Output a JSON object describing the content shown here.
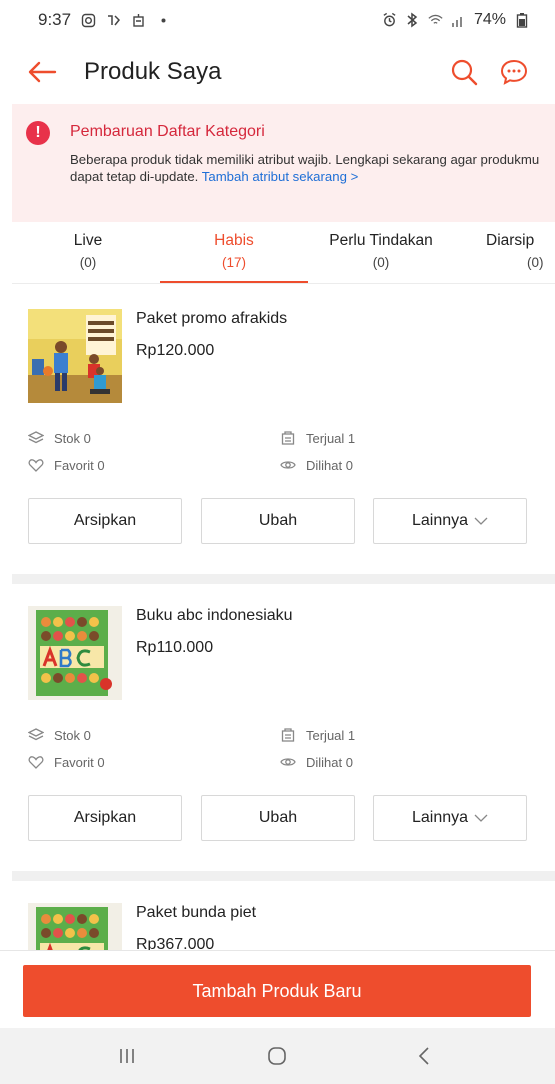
{
  "status_bar": {
    "time": "9:37",
    "battery": "74%",
    "left_icons": [
      "instagram-icon",
      "app-icon",
      "notification-icon",
      "dot-icon"
    ],
    "right_icons": [
      "alarm-icon",
      "bluetooth-icon",
      "wifi-icon",
      "signal-icon",
      "battery-icon"
    ]
  },
  "header": {
    "title": "Produk Saya",
    "back_icon": "arrow-left-icon",
    "search_icon": "search-icon",
    "chat_icon": "chat-icon"
  },
  "banner": {
    "icon": "!",
    "title": "Pembaruan Daftar Kategori",
    "text": "Beberapa produk tidak memiliki atribut wajib. Lengkapi sekarang agar produkmu dapat tetap di-update.",
    "link": "Tambah atribut sekarang >"
  },
  "tabs": [
    {
      "label": "Live",
      "count": "(0)"
    },
    {
      "label": "Habis",
      "count": "(17)"
    },
    {
      "label": "Perlu Tindakan",
      "count": "(0)"
    },
    {
      "label": "Diarsip",
      "count": "(0)"
    }
  ],
  "active_tab": "Habis",
  "stat_labels": {
    "stok": "Stok 0",
    "terjual": "Terjual 1",
    "favorit": "Favorit 0",
    "dilihat": "Dilihat 0"
  },
  "buttons": {
    "archive": "Arsipkan",
    "edit": "Ubah",
    "more": "Lainnya"
  },
  "products": [
    {
      "name": "Paket promo afrakids",
      "price": "Rp120.000"
    },
    {
      "name": "Buku abc indonesiaku",
      "price": "Rp110.000"
    },
    {
      "name": "Paket bunda piet",
      "price": "Rp367.000"
    }
  ],
  "cta_label": "Tambah Produk Baru",
  "nav_icons": [
    "recent-apps-icon",
    "home-icon",
    "back-icon"
  ],
  "colors": {
    "accent": "#ee4d2d",
    "banner_bg": "#fdeeee",
    "banner_title": "#d5283c",
    "link": "#1f6fd6"
  }
}
